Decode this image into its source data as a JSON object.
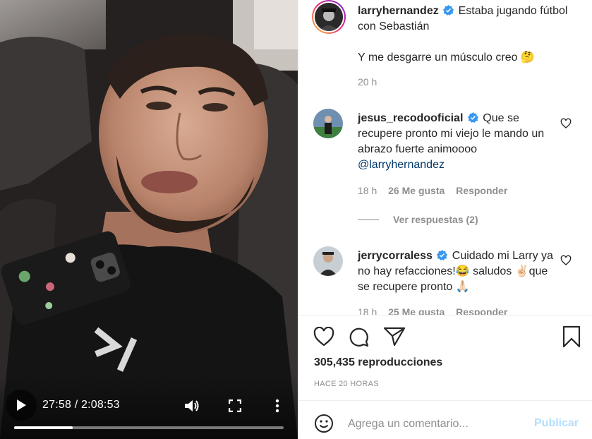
{
  "video": {
    "current_time": "27:58",
    "separator": " / ",
    "duration": "2:08:53",
    "progress_fraction": 0.2171,
    "icons": {
      "play": "play-icon",
      "volume": "volume-icon",
      "fullscreen": "fullscreen-icon",
      "more": "more-vertical-icon"
    }
  },
  "post": {
    "author": "larryhernandez",
    "caption_line1": "Estaba jugando fútbol con Sebastián",
    "caption_line2": "Y me desgarre un músculo creo 🤔",
    "time_ago": "20 h"
  },
  "comments": [
    {
      "username": "jesus_recodooficial",
      "text": "Que se recupere pronto mi viejo le mando un abrazo fuerte animoooo",
      "mention": "@larryhernandez",
      "time": "18 h",
      "likes": "26 Me gusta",
      "reply_label": "Responder",
      "view_replies": "Ver respuestas (2)"
    },
    {
      "username": "jerrycorraless",
      "text": "Cuidado mi Larry ya no hay refacciones!😂 saludos ✌🏻que se recupere pronto 🙏🏻",
      "time": "18 h",
      "likes": "25 Me gusta",
      "reply_label": "Responder"
    }
  ],
  "actions": {
    "like_icon": "heart-icon",
    "comment_icon": "comment-icon",
    "share_icon": "share-icon",
    "save_icon": "bookmark-icon"
  },
  "stats": {
    "views": "305,435 reproducciones",
    "posted_ago": "HACE 20 HORAS"
  },
  "composer": {
    "placeholder": "Agrega un comentario...",
    "publish_label": "Publicar",
    "emoji_icon": "emoji-icon"
  },
  "colors": {
    "verified_blue": "#3897f0",
    "publish_disabled": "#b2dffc",
    "muted_text": "#8e8e8e",
    "mention": "#00376b"
  }
}
